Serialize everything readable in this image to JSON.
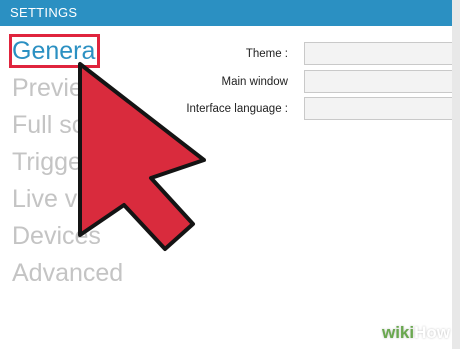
{
  "window": {
    "title": "SETTINGS"
  },
  "nav": {
    "items": [
      {
        "label": "General"
      },
      {
        "label": "Previe"
      },
      {
        "label": "Full sc"
      },
      {
        "label": "Trigge"
      },
      {
        "label": "Live v"
      },
      {
        "label": "Devices"
      },
      {
        "label": "Advanced"
      }
    ],
    "active_index": 0
  },
  "form": {
    "theme_label": "Theme :",
    "main_window_label": "Main window",
    "interface_language_label": "Interface language :",
    "theme_value": "",
    "main_window_value": "",
    "interface_language_value": ""
  },
  "watermark": {
    "part1": "wiki",
    "part2": "How"
  },
  "colors": {
    "accent": "#2b90c2",
    "highlight_border": "#e0243d",
    "pointer_fill": "#d92b3d",
    "inactive_nav": "#c4c4c4"
  },
  "icons": {
    "pointer": "arrow-cursor-icon"
  }
}
